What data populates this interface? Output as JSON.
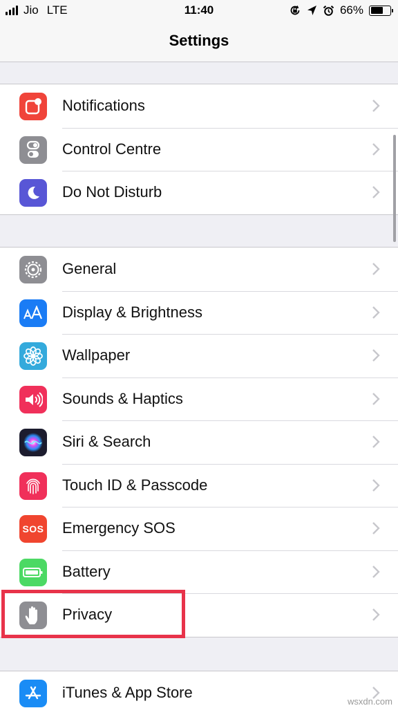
{
  "status_bar": {
    "carrier": "Jio",
    "network": "LTE",
    "time": "11:40",
    "battery_percent_text": "66%",
    "battery_level": 0.66
  },
  "nav": {
    "title": "Settings"
  },
  "groups": [
    {
      "items": [
        {
          "label": "Notifications",
          "icon": "notifications-icon",
          "color": "#f0443a"
        },
        {
          "label": "Control Centre",
          "icon": "control-centre-icon",
          "color": "#8e8e93"
        },
        {
          "label": "Do Not Disturb",
          "icon": "moon-icon",
          "color": "#5856d6"
        }
      ]
    },
    {
      "items": [
        {
          "label": "General",
          "icon": "gear-icon",
          "color": "#8e8e93"
        },
        {
          "label": "Display & Brightness",
          "icon": "display-aa-icon",
          "color": "#1a7cf5"
        },
        {
          "label": "Wallpaper",
          "icon": "wallpaper-flower-icon",
          "color": "#34aadc"
        },
        {
          "label": "Sounds & Haptics",
          "icon": "speaker-icon",
          "color": "#f0305a"
        },
        {
          "label": "Siri & Search",
          "icon": "siri-icon",
          "color": "#1c1c2e"
        },
        {
          "label": "Touch ID & Passcode",
          "icon": "fingerprint-icon",
          "color": "#f0305a"
        },
        {
          "label": "Emergency SOS",
          "icon": "sos-icon",
          "color": "#f0452f",
          "icon_text": "SOS"
        },
        {
          "label": "Battery",
          "icon": "battery-icon",
          "color": "#4cd964"
        },
        {
          "label": "Privacy",
          "icon": "hand-icon",
          "color": "#8e8e93"
        }
      ]
    },
    {
      "items": [
        {
          "label": "iTunes & App Store",
          "icon": "app-store-icon",
          "color": "#1a8cf5"
        }
      ]
    }
  ],
  "watermark": "wsxdn.com",
  "colors": {
    "highlight": "#e8334a",
    "background": "#efeff4"
  }
}
